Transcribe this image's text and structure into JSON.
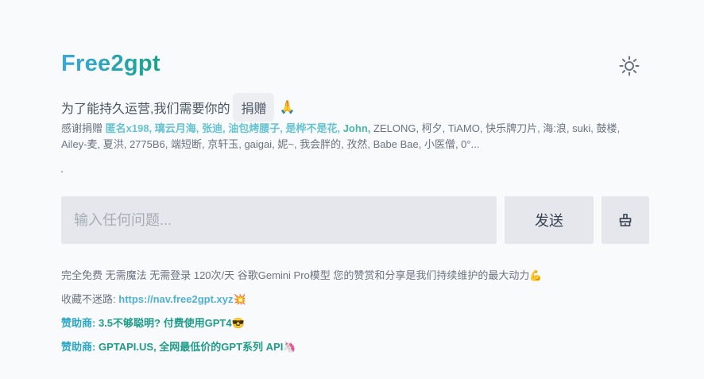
{
  "header": {
    "title": "Free2gpt",
    "theme_icon": "sun-icon"
  },
  "donate": {
    "text": "为了能持久运营,我们需要你的",
    "button_label": "捐赠",
    "emoji": "🙏"
  },
  "thanks": {
    "prefix": "感谢捐赠",
    "highlighted": "匿名x198, 璃云月海, 张迪, 油包烤腰子, 是桦不是花,",
    "highlighted2": "John,",
    "rest": "ZELONG, 柯夕, TiAMO, 快乐牌刀片, 海:浪, suki, 鼓楼, Ailey-麦, 夏洪, 2775B6, 端短断, 京轩玉, gaigai, 妮~, 我会胖的, 孜然, Babe Bae, 小医僧, 0°...",
    "dot": "."
  },
  "chat": {
    "input_value": "",
    "placeholder": "输入任何问题...",
    "send_label": "发送",
    "clear_icon": "clear-history-icon"
  },
  "footer": {
    "info": "完全免费 无需魔法 无需登录 120次/天 谷歌Gemini Pro模型 您的赞赏和分享是我们持续维护的最大动力💪",
    "bookmark_label": "收藏不迷路:",
    "bookmark_link": "https://nav.free2gpt.xyz",
    "bookmark_emoji": "💥",
    "sponsor1_label": "赞助商:",
    "sponsor1_text": "3.5不够聪明? 付费使用GPT4😎",
    "sponsor2_label": "赞助商:",
    "sponsor2_text": "GPTAPI.US, 全网最低价的GPT系列 API🦄"
  }
}
